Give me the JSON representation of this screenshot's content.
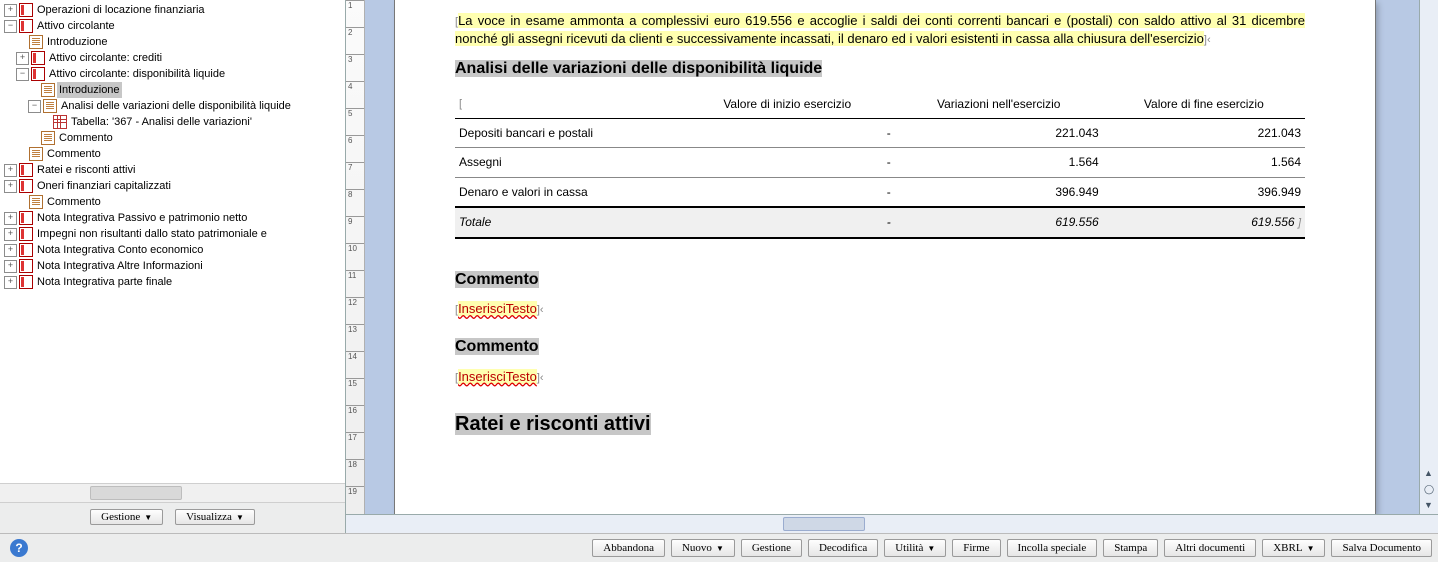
{
  "tree": {
    "n0": "Operazioni di locazione finanziaria",
    "n1": "Attivo circolante",
    "n1a": "Introduzione",
    "n1b": "Attivo circolante: crediti",
    "n1c": "Attivo circolante: disponibilità liquide",
    "n1c1": "Introduzione",
    "n1c2": "Analisi delle variazioni delle disponibilità liquide",
    "n1c2t": "Tabella: '367 - Analisi delle variazioni'",
    "n1c3": "Commento",
    "n1d": "Commento",
    "n2": "Ratei e risconti attivi",
    "n3": "Oneri finanziari capitalizzati",
    "n3a": "Commento",
    "n4": "Nota Integrativa Passivo e patrimonio netto",
    "n5": "Impegni non risultanti dallo stato patrimoniale e",
    "n6": "Nota Integrativa Conto economico",
    "n7": "Nota Integrativa Altre Informazioni",
    "n8": "Nota Integrativa parte finale"
  },
  "left_buttons": {
    "gestione": "Gestione",
    "visualizza": "Visualizza"
  },
  "doc": {
    "intro": "La voce in esame ammonta a complessivi euro 619.556 e accoglie i saldi dei conti correnti bancari e (postali) con saldo attivo al 31 dicembre  nonché gli assegni ricevuti da clienti e successivamente incassati, il denaro ed i valori esistenti in cassa alla chiusura dell'esercizio",
    "h_analisi": "Analisi delle variazioni delle disponibilità liquide",
    "h_commento": "Commento",
    "placeholder": "InserisciTesto",
    "h_ratei": "Ratei e risconti attivi"
  },
  "table": {
    "col1": "Valore di inizio esercizio",
    "col2": "Variazioni nell'esercizio",
    "col3": "Valore di fine esercizio",
    "r1": {
      "label": "Depositi bancari e postali",
      "v1": "-",
      "v2": "221.043",
      "v3": "221.043"
    },
    "r2": {
      "label": "Assegni",
      "v1": "-",
      "v2": "1.564",
      "v3": "1.564"
    },
    "r3": {
      "label": "Denaro e valori in cassa",
      "v1": "-",
      "v2": "396.949",
      "v3": "396.949"
    },
    "tot": {
      "label": "Totale",
      "v1": "-",
      "v2": "619.556",
      "v3": "619.556"
    }
  },
  "buttons": {
    "abbandona": "Abbandona",
    "nuovo": "Nuovo",
    "gestione": "Gestione",
    "decodifica": "Decodifica",
    "utilita": "Utilità",
    "firme": "Firme",
    "incolla": "Incolla speciale",
    "stampa": "Stampa",
    "altri": "Altri documenti",
    "xbrl": "XBRL",
    "salva": "Salva Documento"
  },
  "ruler_ticks": [
    "1",
    "2",
    "3",
    "4",
    "5",
    "6",
    "7",
    "8",
    "9",
    "10",
    "11",
    "12",
    "13",
    "14",
    "15",
    "16",
    "17",
    "18",
    "19"
  ]
}
